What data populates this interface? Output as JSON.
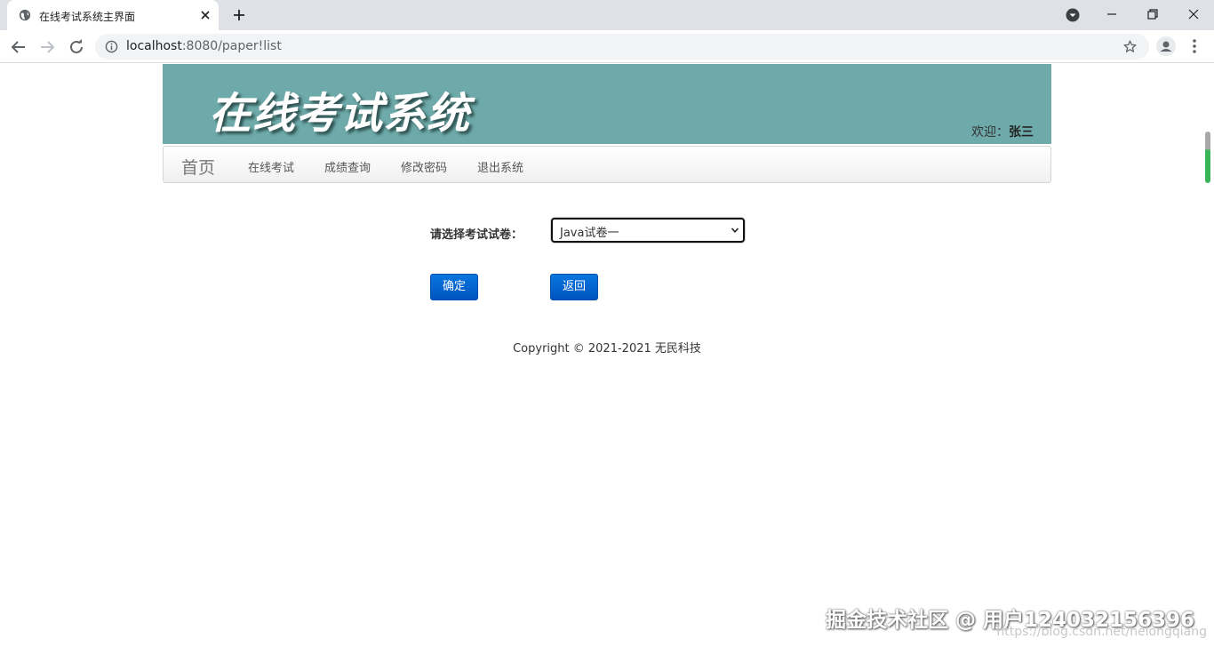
{
  "browser": {
    "tab_title": "在线考试系统主界面",
    "url_host": "localhost",
    "url_path": ":8080/paper!list",
    "icons": {
      "favicon": "globe-icon",
      "tab_close": "close-icon",
      "new_tab": "plus-icon",
      "profile_dropdown": "chevron-down-circle-icon",
      "back": "arrow-left-icon",
      "forward": "arrow-right-icon",
      "reload": "reload-icon",
      "site_info": "info-icon",
      "bookmark": "star-icon",
      "account": "person-icon",
      "menu": "more-vert-icon"
    }
  },
  "header": {
    "logo_text": "在线考试系统",
    "welcome_prefix": "欢迎：",
    "username": "张三",
    "background_color": "#6eaaa9"
  },
  "navbar": {
    "brand": "首页",
    "items": [
      {
        "label": "在线考试"
      },
      {
        "label": "成绩查询"
      },
      {
        "label": "修改密码"
      },
      {
        "label": "退出系统"
      }
    ]
  },
  "form": {
    "select_label": "请选择考试试卷：",
    "select_value": "Java试卷一",
    "confirm_label": "确定",
    "back_label": "返回",
    "button_color": "#0a6ad6"
  },
  "footer": {
    "copyright": "Copyright © 2021-2021 无民科技"
  },
  "watermark": {
    "main": "掘金技术社区 @ 用户124032156396",
    "sub": "https://blog.csdn.net/helongqiang"
  }
}
